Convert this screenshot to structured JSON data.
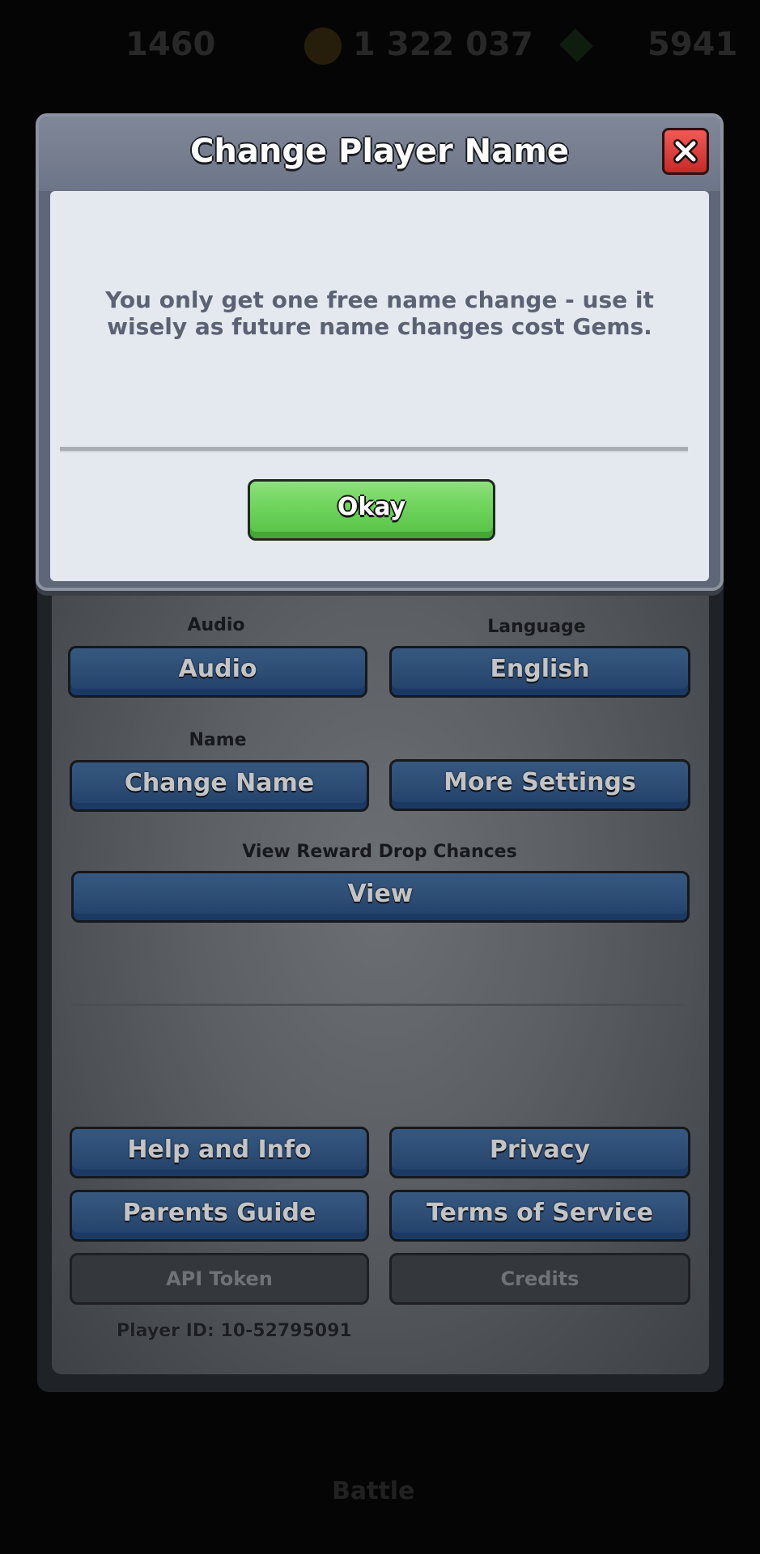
{
  "hud": {
    "trophies": "1460",
    "gold": "1 322 037",
    "gems": "5941"
  },
  "bottom_hud": {
    "battle_label": "Battle"
  },
  "modal": {
    "title": "Change Player Name",
    "message": "You only get one free name change - use it wisely as future name changes cost Gems.",
    "okay_label": "Okay"
  },
  "settings": {
    "audio_label": "Audio",
    "audio_button": "Audio",
    "language_label": "Language",
    "language_button": "English",
    "name_label": "Name",
    "change_name_button": "Change Name",
    "more_settings_button": "More Settings",
    "reward_label": "View Reward Drop Chances",
    "view_button": "View",
    "help_button": "Help and Info",
    "privacy_button": "Privacy",
    "parents_button": "Parents Guide",
    "terms_button": "Terms of Service",
    "api_button": "API Token",
    "credits_button": "Credits",
    "player_id": "Player ID: 10-52795091"
  }
}
